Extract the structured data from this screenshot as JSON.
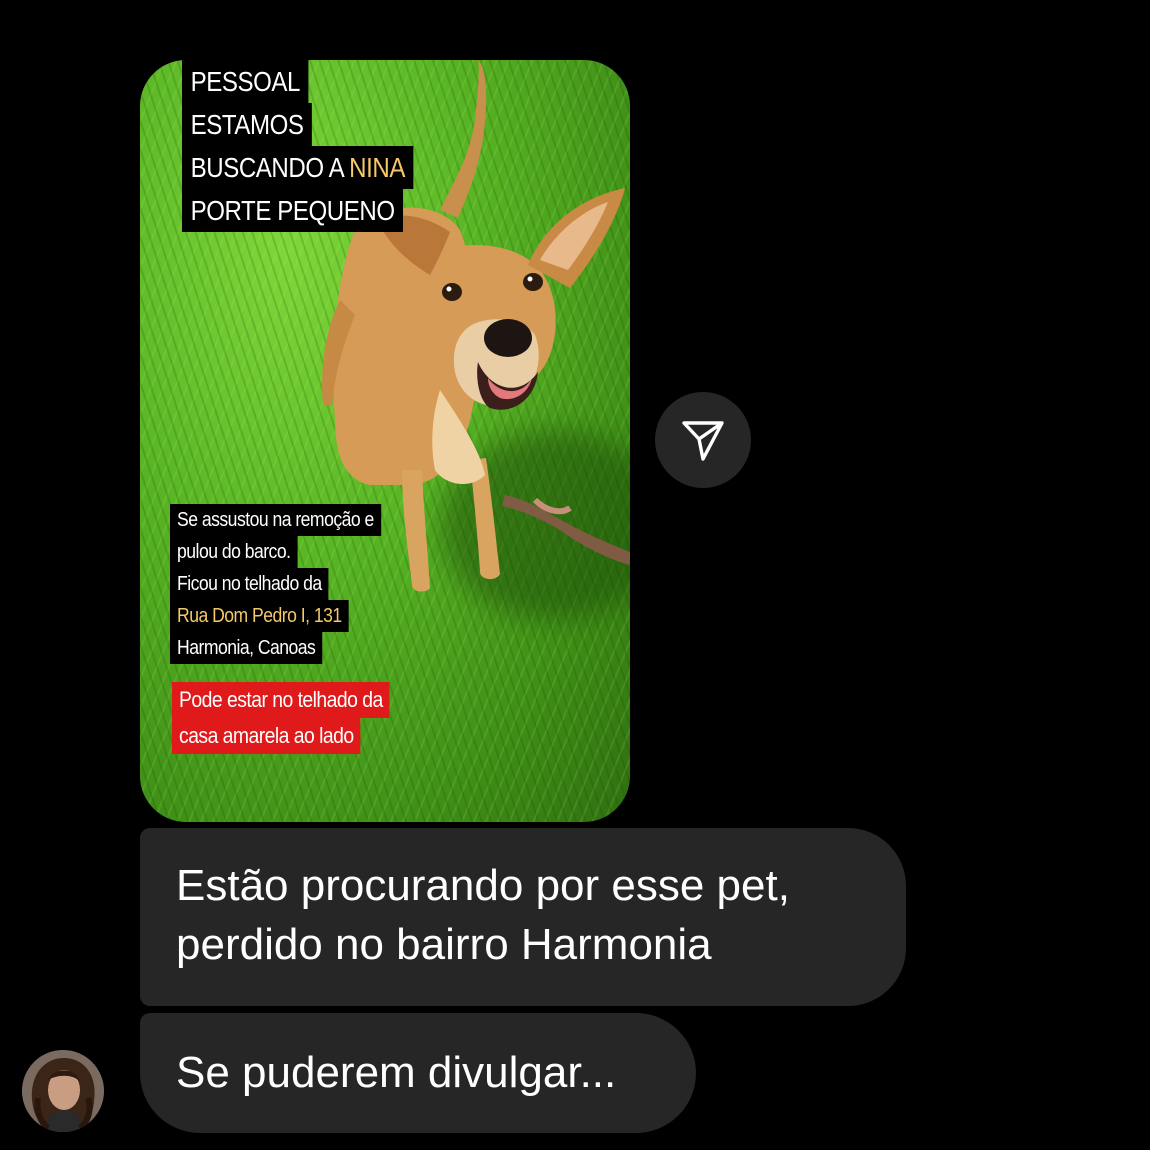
{
  "story": {
    "headline_lines": [
      {
        "text": "PESSOAL",
        "highlight": ""
      },
      {
        "text": "ESTAMOS",
        "highlight": ""
      },
      {
        "text": "BUSCANDO A ",
        "highlight": "NINA"
      },
      {
        "text": "PORTE PEQUENO",
        "highlight": ""
      }
    ],
    "info_lines": [
      "Se assustou na remoção e",
      "pulou do barco.",
      "Ficou no telhado da"
    ],
    "address_line": "Rua Dom Pedro I, 131",
    "city_line": "Harmonia, Canoas",
    "alert_lines": [
      "Pode estar no telhado da",
      "casa amarela ao lado"
    ],
    "highlight_color": "#f5c86a",
    "alert_color": "#e0191b"
  },
  "share": {
    "icon": "paper-plane-icon"
  },
  "messages": [
    {
      "lines": [
        "Estão procurando por esse pet,",
        "perdido no bairro Harmonia"
      ]
    },
    {
      "lines": [
        "Se puderem divulgar..."
      ]
    }
  ],
  "sender": {
    "avatar_icon": "avatar-icon"
  },
  "theme": {
    "background": "#000000",
    "bubble": "#262626",
    "text": "#ffffff"
  }
}
